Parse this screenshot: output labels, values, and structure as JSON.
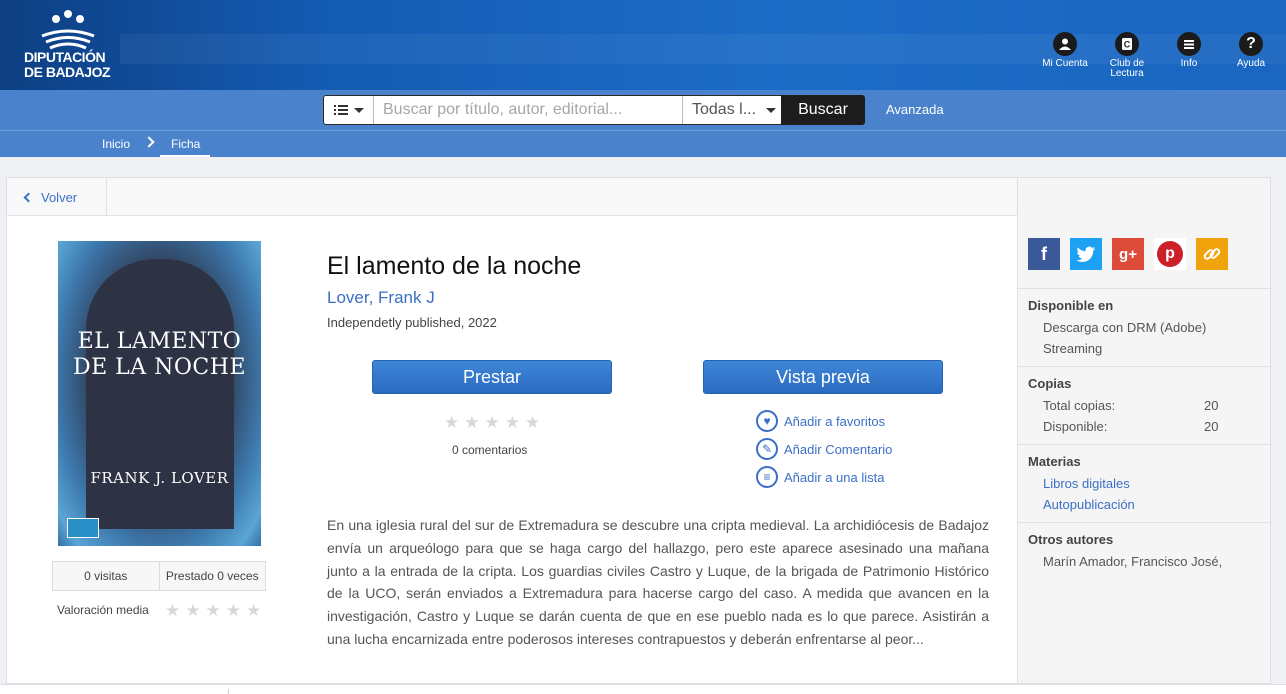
{
  "header": {
    "logo_line1": "DIPUTACIÓN",
    "logo_line2": "DE BADAJOZ",
    "nav": [
      {
        "label": "Mi Cuenta",
        "icon": "user-icon"
      },
      {
        "label": "Club de\nLectura",
        "icon": "reading-club-icon"
      },
      {
        "label": "Info",
        "icon": "menu-icon"
      },
      {
        "label": "Ayuda",
        "icon": "help-icon"
      }
    ]
  },
  "search": {
    "placeholder": "Buscar por título, autor, editorial...",
    "scope": "Todas l...",
    "button": "Buscar",
    "advanced": "Avanzada"
  },
  "breadcrumb": {
    "home": "Inicio",
    "current": "Ficha"
  },
  "toolbar": {
    "back": "Volver"
  },
  "book": {
    "cover_title": "EL LAMENTO DE LA NOCHE",
    "cover_author": "FRANK J. LOVER",
    "title": "El lamento de la noche",
    "author": "Lover, Frank J",
    "publisher": "Independetly published, 2022",
    "visits": "0 visitas",
    "loans": "Prestado 0 veces",
    "rating_label": "Valoración media",
    "comments": "0 comentarios",
    "borrow_button": "Prestar",
    "preview_button": "Vista previa",
    "actions": {
      "favorites": "Añadir a favoritos",
      "comment": "Añadir Comentario",
      "list": "Añadir a una lista"
    },
    "description": "En una iglesia rural del sur de Extremadura se descubre una cripta medieval. La archidiócesis de Badajoz envía un arqueólogo para que se haga cargo del hallazgo, pero este aparece asesinado una mañana junto a la entrada de la cripta. Los guardias civiles Castro y Luque, de la brigada de Patrimonio Histórico de la UCO, serán enviados a Extremadura para hacerse cargo del caso. A medida que avancen en la investigación, Castro y Luque se darán cuenta de que en ese pueblo nada es lo que parece. Asistirán a una lucha encarnizada entre poderosos intereses contrapuestos y deberán enfrentarse al peor..."
  },
  "sidebar": {
    "available_title": "Disponible en",
    "available": [
      "Descarga con DRM (Adobe)",
      "Streaming"
    ],
    "copies_title": "Copias",
    "total_label": "Total copias:",
    "total_value": "20",
    "available_label": "Disponible:",
    "available_value": "20",
    "subjects_title": "Materias",
    "subjects": [
      "Libros digitales",
      "Autopublicación"
    ],
    "others_title": "Otros autores",
    "others": [
      "Marín Amador, Francisco José,"
    ]
  },
  "colors": {
    "header_blue": "#1c6cc7",
    "bar_blue": "#4a83cb",
    "link_blue": "#3b6fc6",
    "facebook": "#3b5998",
    "twitter": "#1da1f2",
    "googleplus": "#dd4b39",
    "pinterest": "#cb2027",
    "link_share": "#f0a30a"
  }
}
